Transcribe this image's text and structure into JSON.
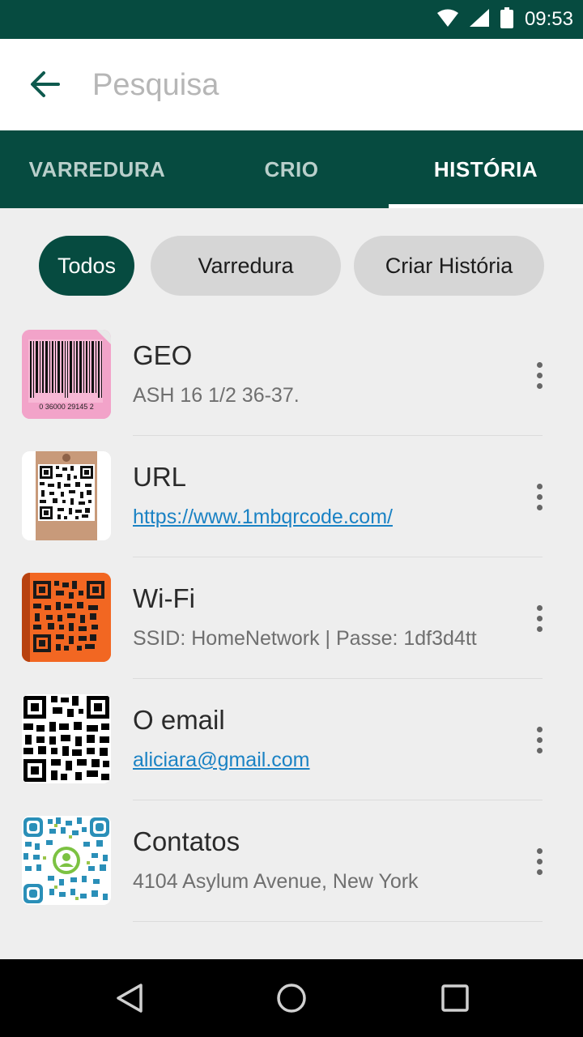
{
  "status": {
    "time": "09:53"
  },
  "search": {
    "placeholder": "Pesquisa"
  },
  "tabs": [
    {
      "label": "VARREDURA",
      "active": false
    },
    {
      "label": "CRIO",
      "active": false
    },
    {
      "label": "HISTÓRIA",
      "active": true
    }
  ],
  "chips": [
    {
      "label": "Todos",
      "active": true
    },
    {
      "label": "Varredura",
      "active": false
    },
    {
      "label": "Criar História",
      "active": false
    }
  ],
  "history": [
    {
      "title": "GEO",
      "subtitle": "ASH 16 1/2 36-37.",
      "thumb": "barcode-thumbnail",
      "barcode_digits": "0  36000  29145  2"
    },
    {
      "title": "URL",
      "subtitle": "https://www.1mbqrcode.com/",
      "thumb": "qr-tag-thumbnail"
    },
    {
      "title": "Wi-Fi",
      "subtitle": "SSID: HomeNetwork | Passe: 1df3d4tt",
      "thumb": "qr-orange-thumbnail"
    },
    {
      "title": "O email",
      "subtitle": "aliciara@gmail.com",
      "thumb": "qr-black-thumbnail"
    },
    {
      "title": "Contatos",
      "subtitle": "4104  Asylum Avenue, New York",
      "thumb": "qr-blue-thumbnail"
    }
  ],
  "colors": {
    "primary": "#064b40",
    "link": "#1a82c4",
    "chip_inactive": "#d6d6d6",
    "background": "#eeeeee"
  }
}
